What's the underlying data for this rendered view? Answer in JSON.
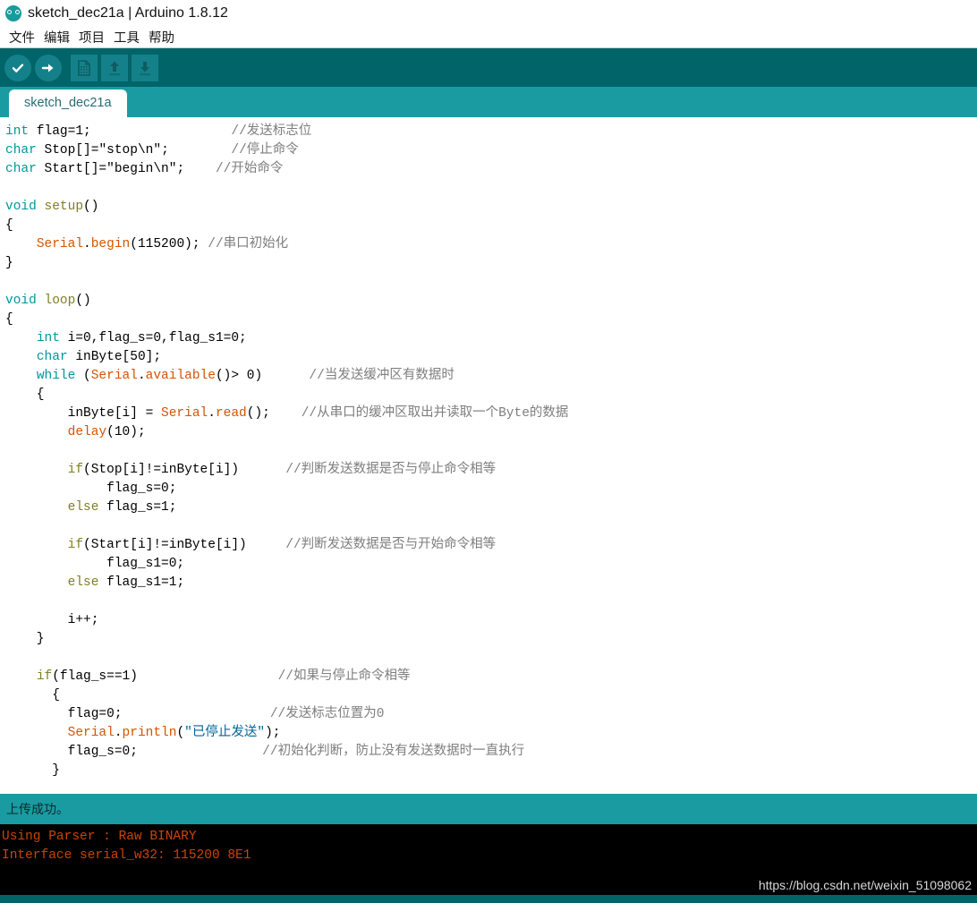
{
  "window": {
    "title": "sketch_dec21a | Arduino 1.8.12",
    "logo_icon": "arduino-infinity-icon"
  },
  "menubar": {
    "items": [
      {
        "label": "文件",
        "name": "menu-file"
      },
      {
        "label": "编辑",
        "name": "menu-edit"
      },
      {
        "label": "项目",
        "name": "menu-sketch"
      },
      {
        "label": "工具",
        "name": "menu-tools"
      },
      {
        "label": "帮助",
        "name": "menu-help"
      }
    ]
  },
  "toolbar": {
    "buttons": [
      {
        "name": "verify-button",
        "icon": "checkmark-icon",
        "shape": "round"
      },
      {
        "name": "upload-button",
        "icon": "arrow-right-icon",
        "shape": "round"
      },
      {
        "name": "new-button",
        "icon": "new-document-icon",
        "shape": "square"
      },
      {
        "name": "open-button",
        "icon": "arrow-up-open-icon",
        "shape": "square"
      },
      {
        "name": "save-button",
        "icon": "arrow-down-save-icon",
        "shape": "square"
      }
    ]
  },
  "tabs": [
    {
      "label": "sketch_dec21a",
      "active": true
    }
  ],
  "editor": {
    "lines": [
      [
        {
          "t": "int",
          "c": "kw"
        },
        {
          "t": " flag=1;",
          "c": "plain"
        },
        {
          "t": "                  ",
          "c": "plain"
        },
        {
          "t": "//发送标志位",
          "c": "cmt"
        }
      ],
      [
        {
          "t": "char",
          "c": "kw"
        },
        {
          "t": " Stop[]=",
          "c": "plain"
        },
        {
          "t": "\"stop\\n\"",
          "c": "plain"
        },
        {
          "t": ";",
          "c": "plain"
        },
        {
          "t": "        ",
          "c": "plain"
        },
        {
          "t": "//停止命令",
          "c": "cmt"
        }
      ],
      [
        {
          "t": "char",
          "c": "kw"
        },
        {
          "t": " Start[]=",
          "c": "plain"
        },
        {
          "t": "\"begin\\n\"",
          "c": "plain"
        },
        {
          "t": ";",
          "c": "plain"
        },
        {
          "t": "    ",
          "c": "plain"
        },
        {
          "t": "//开始命令",
          "c": "cmt"
        }
      ],
      [],
      [
        {
          "t": "void",
          "c": "kw"
        },
        {
          "t": " ",
          "c": "plain"
        },
        {
          "t": "setup",
          "c": "ctrl"
        },
        {
          "t": "()",
          "c": "plain"
        }
      ],
      [
        {
          "t": "{",
          "c": "plain"
        }
      ],
      [
        {
          "t": "    ",
          "c": "plain"
        },
        {
          "t": "Serial",
          "c": "fn"
        },
        {
          "t": ".",
          "c": "plain"
        },
        {
          "t": "begin",
          "c": "fn"
        },
        {
          "t": "(115200); ",
          "c": "plain"
        },
        {
          "t": "//串口初始化",
          "c": "cmt"
        }
      ],
      [
        {
          "t": "}",
          "c": "plain"
        }
      ],
      [],
      [
        {
          "t": "void",
          "c": "kw"
        },
        {
          "t": " ",
          "c": "plain"
        },
        {
          "t": "loop",
          "c": "ctrl"
        },
        {
          "t": "()",
          "c": "plain"
        }
      ],
      [
        {
          "t": "{",
          "c": "plain"
        }
      ],
      [
        {
          "t": "    ",
          "c": "plain"
        },
        {
          "t": "int",
          "c": "kw"
        },
        {
          "t": " i=0,flag_s=0,flag_s1=0;",
          "c": "plain"
        }
      ],
      [
        {
          "t": "    ",
          "c": "plain"
        },
        {
          "t": "char",
          "c": "kw"
        },
        {
          "t": " inByte[50];",
          "c": "plain"
        }
      ],
      [
        {
          "t": "    ",
          "c": "plain"
        },
        {
          "t": "while",
          "c": "kw"
        },
        {
          "t": " (",
          "c": "plain"
        },
        {
          "t": "Serial",
          "c": "fn"
        },
        {
          "t": ".",
          "c": "plain"
        },
        {
          "t": "available",
          "c": "fn"
        },
        {
          "t": "()> 0)",
          "c": "plain"
        },
        {
          "t": "      ",
          "c": "plain"
        },
        {
          "t": "//当发送缓冲区有数据时",
          "c": "cmt"
        }
      ],
      [
        {
          "t": "    {",
          "c": "plain"
        }
      ],
      [
        {
          "t": "        inByte[i] = ",
          "c": "plain"
        },
        {
          "t": "Serial",
          "c": "fn"
        },
        {
          "t": ".",
          "c": "plain"
        },
        {
          "t": "read",
          "c": "fn"
        },
        {
          "t": "();",
          "c": "plain"
        },
        {
          "t": "    ",
          "c": "plain"
        },
        {
          "t": "//从串口的缓冲区取出并读取一个Byte的数据",
          "c": "cmt"
        }
      ],
      [
        {
          "t": "        ",
          "c": "plain"
        },
        {
          "t": "delay",
          "c": "fn"
        },
        {
          "t": "(10);",
          "c": "plain"
        }
      ],
      [],
      [
        {
          "t": "        ",
          "c": "plain"
        },
        {
          "t": "if",
          "c": "ctrl"
        },
        {
          "t": "(Stop[i]!=inByte[i])",
          "c": "plain"
        },
        {
          "t": "      ",
          "c": "plain"
        },
        {
          "t": "//判断发送数据是否与停止命令相等",
          "c": "cmt"
        }
      ],
      [
        {
          "t": "             flag_s=0;",
          "c": "plain"
        }
      ],
      [
        {
          "t": "        ",
          "c": "plain"
        },
        {
          "t": "else",
          "c": "ctrl"
        },
        {
          "t": " flag_s=1;",
          "c": "plain"
        }
      ],
      [],
      [
        {
          "t": "        ",
          "c": "plain"
        },
        {
          "t": "if",
          "c": "ctrl"
        },
        {
          "t": "(Start[i]!=inByte[i])",
          "c": "plain"
        },
        {
          "t": "     ",
          "c": "plain"
        },
        {
          "t": "//判断发送数据是否与开始命令相等",
          "c": "cmt"
        }
      ],
      [
        {
          "t": "             flag_s1=0;",
          "c": "plain"
        }
      ],
      [
        {
          "t": "        ",
          "c": "plain"
        },
        {
          "t": "else",
          "c": "ctrl"
        },
        {
          "t": " flag_s1=1;",
          "c": "plain"
        }
      ],
      [],
      [
        {
          "t": "        i++;",
          "c": "plain"
        }
      ],
      [
        {
          "t": "    }",
          "c": "plain"
        }
      ],
      [],
      [
        {
          "t": "    ",
          "c": "plain"
        },
        {
          "t": "if",
          "c": "ctrl"
        },
        {
          "t": "(flag_s==1)",
          "c": "plain"
        },
        {
          "t": "                  ",
          "c": "plain"
        },
        {
          "t": "//如果与停止命令相等",
          "c": "cmt"
        }
      ],
      [
        {
          "t": "      {",
          "c": "plain"
        }
      ],
      [
        {
          "t": "        flag=0;",
          "c": "plain"
        },
        {
          "t": "                   ",
          "c": "plain"
        },
        {
          "t": "//发送标志位置为0",
          "c": "cmt"
        }
      ],
      [
        {
          "t": "        ",
          "c": "plain"
        },
        {
          "t": "Serial",
          "c": "fn"
        },
        {
          "t": ".",
          "c": "plain"
        },
        {
          "t": "println",
          "c": "fn"
        },
        {
          "t": "(",
          "c": "plain"
        },
        {
          "t": "\"已停止发送\"",
          "c": "str"
        },
        {
          "t": ");",
          "c": "plain"
        }
      ],
      [
        {
          "t": "        flag_s=0;",
          "c": "plain"
        },
        {
          "t": "                ",
          "c": "plain"
        },
        {
          "t": "//初始化判断，防止没有发送数据时一直执行",
          "c": "cmt"
        }
      ],
      [
        {
          "t": "      }",
          "c": "plain"
        }
      ]
    ]
  },
  "status": {
    "message": "上传成功。"
  },
  "console": {
    "lines": [
      "Using Parser : Raw BINARY",
      "Interface serial_w32: 115200 8E1"
    ]
  },
  "watermark": {
    "text": "https://blog.csdn.net/weixin_51098062"
  },
  "colors": {
    "toolbar_bg": "#006468",
    "tabstrip_bg": "#1a9ba1",
    "status_bg": "#1a9ba1",
    "console_bg": "#000000",
    "console_text": "#cc4400",
    "keyword": "#00979c",
    "function": "#d35400",
    "control": "#7f7f22",
    "comment": "#7e7e7e",
    "string": "#006699"
  }
}
